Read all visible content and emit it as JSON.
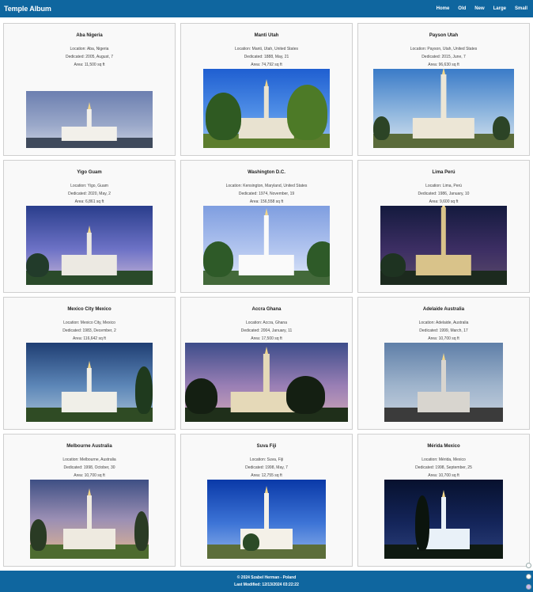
{
  "header": {
    "title": "Temple Album",
    "nav": [
      "Home",
      "Old",
      "New",
      "Large",
      "Small"
    ]
  },
  "labels": {
    "location": "Location: ",
    "dedicated": "Dedicated: ",
    "area": "Area: "
  },
  "temples": [
    {
      "name": "Aba Nigeria",
      "location": "Aba, Nigeria",
      "dedicated": "2005, August, 7",
      "area": "11,500 sq ft"
    },
    {
      "name": "Manti Utah",
      "location": "Manti, Utah, United States",
      "dedicated": "1888, May, 21",
      "area": "74,792 sq ft"
    },
    {
      "name": "Payson Utah",
      "location": "Payson, Utah, United States",
      "dedicated": "2015, June, 7",
      "area": "96,630 sq ft"
    },
    {
      "name": "Yigo Guam",
      "location": "Yigo, Guam",
      "dedicated": "2020, May, 2",
      "area": "6,861 sq ft"
    },
    {
      "name": "Washington D.C.",
      "location": "Kensington, Maryland, United States",
      "dedicated": "1974, November, 19",
      "area": "156,558 sq ft"
    },
    {
      "name": "Lima Perú",
      "location": "Lima, Perú",
      "dedicated": "1986, January, 10",
      "area": "9,600 sq ft"
    },
    {
      "name": "Mexico City Mexico",
      "location": "Mexico City, Mexico",
      "dedicated": "1983, December, 2",
      "area": "116,642 sq ft"
    },
    {
      "name": "Accra Ghana",
      "location": "Accra, Ghana",
      "dedicated": "2004, January, 11",
      "area": "17,500 sq ft"
    },
    {
      "name": "Adelaide Australia",
      "location": "Adelaide, Australia",
      "dedicated": "1999, March, 17",
      "area": "10,700 sq ft"
    },
    {
      "name": "Melbourne Australia",
      "location": "Melbourne, Australia",
      "dedicated": "1998, October, 30",
      "area": "10,700 sq ft"
    },
    {
      "name": "Suva Fiji",
      "location": "Suva, Fiji",
      "dedicated": "1998, May, 7",
      "area": "12,755 sq ft"
    },
    {
      "name": "Mérida Mexico",
      "location": "Mérida, Mexico",
      "dedicated": "1998, September, 25",
      "area": "10,700 sq ft"
    }
  ],
  "footer": {
    "copyright": "© 2024 Szabel Herman - Poland",
    "last_modified": "Last Modified: 12/13/2024 03:22:22"
  }
}
